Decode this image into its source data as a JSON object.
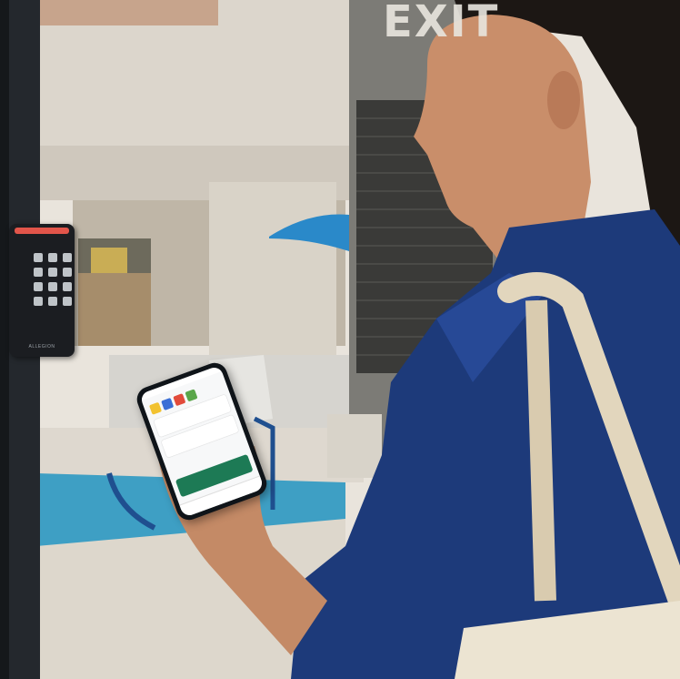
{
  "scene": {
    "exit_sign": "EXIT",
    "keypad_brand": "ALLEGION"
  },
  "phone": {
    "tile_colors": [
      "#f2c230",
      "#3b6fd6",
      "#e24b3b",
      "#5aa64a"
    ],
    "accent": "#1d7a55"
  }
}
